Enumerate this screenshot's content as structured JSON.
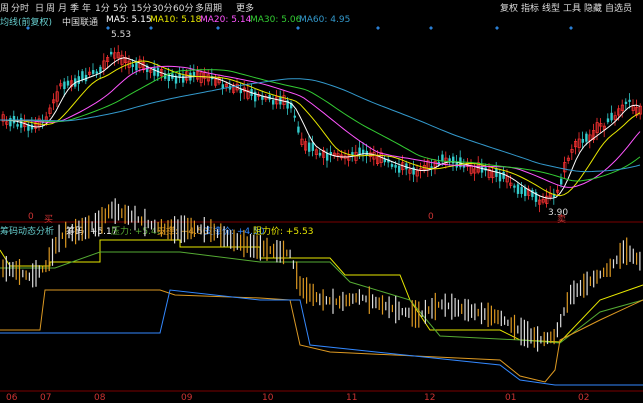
{
  "toolbar": {
    "left_items": [
      "周",
      "分时",
      "日",
      "周",
      "月",
      "季",
      "年",
      "1分",
      "5分",
      "15分",
      "30分",
      "60分",
      "多周期",
      "更多"
    ],
    "right_items": [
      "复权",
      "指标",
      "线型",
      "工具",
      "隐藏",
      "自选员"
    ]
  },
  "price_legend": {
    "label": "均线(前复权)",
    "stock": "中国联通",
    "ma5": "MA5: 5.15",
    "ma10": "MA10: 5.18",
    "ma20": "MA20: 5.14",
    "ma30": "MA30: 5.06",
    "ma60": "MA60: 4.95"
  },
  "indicator_legend": {
    "name": "筹码动态分析",
    "price": "筹码: +5.17",
    "pressure": "压力: +5.40",
    "support": "支撑: +4.50",
    "support2": "支撑价: +4.50",
    "resistance": "阻力价: +5.53"
  },
  "annotations": {
    "high": "5.53",
    "low": "3.90",
    "marker_left": "0",
    "marker_mid": "0",
    "marker_b": "买",
    "marker_s": "卖"
  },
  "x_labels": [
    "06",
    "07",
    "08",
    "09",
    "10",
    "11",
    "12",
    "01",
    "02"
  ],
  "colors": {
    "up": "#ff3333",
    "down": "#33cccc",
    "ma5": "#ffffff",
    "ma10": "#e8e800",
    "ma20": "#ff55ff",
    "ma30": "#33cc33",
    "ma60": "#3399cc",
    "pressure": "#55aa33",
    "support": "#dd9922",
    "support_line": "#3388ff",
    "resistance": "#e8e800",
    "legend_label": "#66cccc"
  },
  "chart_data": {
    "type": "candlestick",
    "price_range": [
      3.9,
      5.53
    ],
    "high_price": 5.53,
    "low_price": 3.9,
    "moving_averages": {
      "MA5": 5.15,
      "MA10": 5.18,
      "MA20": 5.14,
      "MA30": 5.06,
      "MA60": 4.95
    },
    "indicator": {
      "price": 5.17,
      "pressure": 5.4,
      "support": 4.5,
      "support_price": 4.5,
      "resistance_price": 5.53
    }
  }
}
